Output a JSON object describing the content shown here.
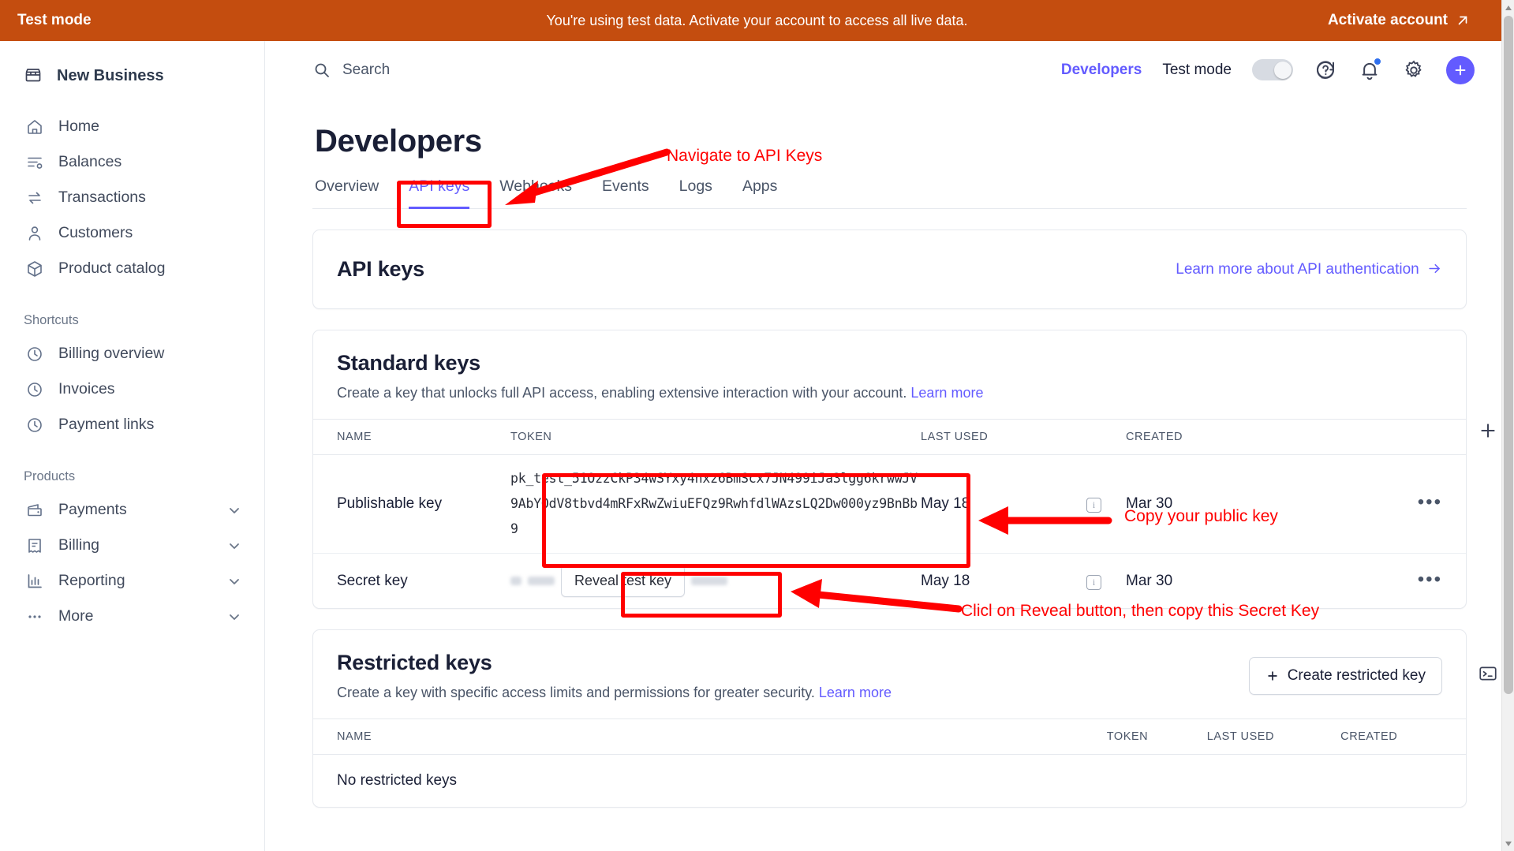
{
  "banner": {
    "left_label": "Test mode",
    "message": "You're using test data. Activate your account to access all live data.",
    "cta": "Activate account",
    "cta_icon": "external-link-arrow-icon",
    "bg": "#c44d0f"
  },
  "sidebar": {
    "business_name": "New Business",
    "business_icon": "storefront-icon",
    "primary_items": [
      {
        "label": "Home",
        "icon": "home-icon"
      },
      {
        "label": "Balances",
        "icon": "balances-icon"
      },
      {
        "label": "Transactions",
        "icon": "transactions-icon"
      },
      {
        "label": "Customers",
        "icon": "customers-icon"
      },
      {
        "label": "Product catalog",
        "icon": "product-catalog-icon"
      }
    ],
    "shortcuts_label": "Shortcuts",
    "shortcuts": [
      {
        "label": "Billing overview",
        "icon": "clock-icon"
      },
      {
        "label": "Invoices",
        "icon": "clock-icon"
      },
      {
        "label": "Payment links",
        "icon": "clock-icon"
      }
    ],
    "products_label": "Products",
    "products": [
      {
        "label": "Payments",
        "icon": "wallet-icon",
        "chevron": "chevron-down-icon"
      },
      {
        "label": "Billing",
        "icon": "receipt-icon",
        "chevron": "chevron-down-icon"
      },
      {
        "label": "Reporting",
        "icon": "bar-chart-icon",
        "chevron": "chevron-down-icon"
      },
      {
        "label": "More",
        "icon": "ellipsis-icon",
        "chevron": "chevron-down-icon"
      }
    ]
  },
  "topnav": {
    "search_placeholder": "Search",
    "search_icon": "search-icon",
    "developers_link": "Developers",
    "test_mode_label": "Test mode",
    "test_mode_on": false,
    "help_icon": "help-circle-icon",
    "notifications_icon": "bell-icon",
    "settings_icon": "gear-icon",
    "create_icon": "plus-icon",
    "accent": "#635bff"
  },
  "page": {
    "title": "Developers",
    "tabs": [
      {
        "label": "Overview",
        "active": false
      },
      {
        "label": "API keys",
        "active": true
      },
      {
        "label": "Webhooks",
        "active": false
      },
      {
        "label": "Events",
        "active": false
      },
      {
        "label": "Logs",
        "active": false
      },
      {
        "label": "Apps",
        "active": false
      }
    ]
  },
  "api_keys_card": {
    "title": "API keys",
    "learn_more_link": "Learn more about API authentication",
    "learn_more_icon": "arrow-right-icon"
  },
  "standard_keys": {
    "title": "Standard keys",
    "description": "Create a key that unlocks full API access, enabling extensive interaction with your account.",
    "learn_more": "Learn more",
    "columns": [
      "NAME",
      "TOKEN",
      "LAST USED",
      "CREATED"
    ],
    "rows": [
      {
        "name": "Publishable key",
        "token": "pk_test_51OzzCkP34wSYxy4nxz6BmScx7JN499iJa3lgg6krwwJV9AbYOdV8tbvd4mRFxRwZwiuEFQz9RwhfdlWAzsLQ2Dw000yz9BnBb9",
        "token_masked": false,
        "last_used": "May 18",
        "created": "Mar 30",
        "info_icon": "info-icon",
        "menu_icon": "overflow-menu-icon"
      },
      {
        "name": "Secret key",
        "token": "",
        "token_masked": true,
        "reveal_button": "Reveal test key",
        "last_used": "May 18",
        "created": "Mar 30",
        "info_icon": "info-icon",
        "menu_icon": "overflow-menu-icon"
      }
    ]
  },
  "restricted_keys": {
    "title": "Restricted keys",
    "description": "Create a key with specific access limits and permissions for greater security.",
    "learn_more": "Learn more",
    "create_button": "Create restricted key",
    "create_button_icon": "plus-icon",
    "columns": [
      "NAME",
      "TOKEN",
      "LAST USED",
      "CREATED"
    ],
    "empty_text": "No restricted keys"
  },
  "right_rail": {
    "add_icon": "plus-icon",
    "terminal_icon": "terminal-icon"
  },
  "annotations": {
    "color": "#ff0000",
    "items": [
      {
        "text": "Navigate to API Keys"
      },
      {
        "text": "Copy your public key"
      },
      {
        "text": "Clicl on Reveal button, then copy this Secret Key"
      }
    ]
  }
}
